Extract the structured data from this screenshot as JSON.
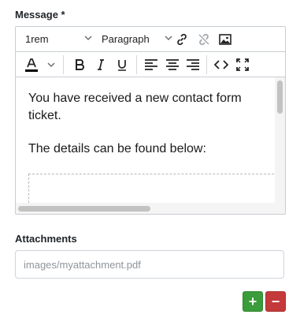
{
  "message_field": {
    "label": "Message *"
  },
  "editor": {
    "font_size": "1rem",
    "block_format": "Paragraph",
    "paragraphs": [
      "You have received a new contact form ticket.",
      "The details can be found below:"
    ],
    "text_color": "#000000",
    "toolbar_icons": [
      "link-icon",
      "unlink-icon",
      "image-icon",
      "text-color-icon",
      "bold-icon",
      "italic-icon",
      "underline-icon",
      "align-left-icon",
      "align-center-icon",
      "align-right-icon",
      "code-icon",
      "fullscreen-icon"
    ]
  },
  "attachments_field": {
    "label": "Attachments",
    "placeholder": "images/myattachment.pdf",
    "add_label": "+",
    "remove_label": "−"
  },
  "colors": {
    "add": "#3a9c3a",
    "remove": "#c43a3a"
  }
}
